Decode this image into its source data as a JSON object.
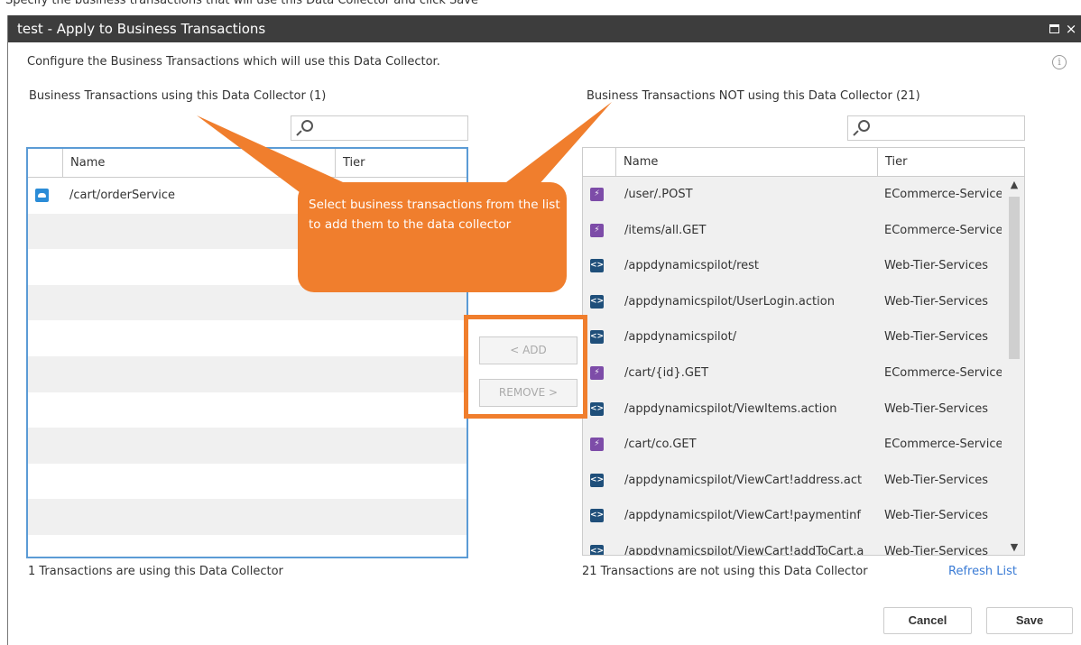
{
  "top_strip": "Specify the business transactions that will use this Data Collector and click Save",
  "dialog": {
    "title": "test - Apply to Business Transactions",
    "description": "Configure the Business Transactions which will use this Data Collector.",
    "close_glyph": "×",
    "info_glyph": "i"
  },
  "left_panel": {
    "label": "Business Transactions using this Data Collector (1)",
    "search_placeholder": "",
    "columns": [
      "Name",
      "Tier"
    ],
    "rows": [
      {
        "name": "/cart/orderService",
        "tier": "",
        "icon": "cloud-icon"
      }
    ],
    "footer": "1 Transactions are using this Data Collector"
  },
  "right_panel": {
    "label": "Business Transactions NOT using this Data Collector (21)",
    "search_placeholder": "",
    "columns": [
      "Name",
      "Tier"
    ],
    "rows": [
      {
        "name": "/user/.POST",
        "tier": "ECommerce-Service",
        "icon": "lightning-icon"
      },
      {
        "name": "/items/all.GET",
        "tier": "ECommerce-Service",
        "icon": "lightning-icon"
      },
      {
        "name": "/appdynamicspilot/rest",
        "tier": "Web-Tier-Services",
        "icon": "code-icon"
      },
      {
        "name": "/appdynamicspilot/UserLogin.action",
        "tier": "Web-Tier-Services",
        "icon": "code-icon"
      },
      {
        "name": "/appdynamicspilot/",
        "tier": "Web-Tier-Services",
        "icon": "code-icon"
      },
      {
        "name": "/cart/{id}.GET",
        "tier": "ECommerce-Service",
        "icon": "lightning-icon"
      },
      {
        "name": "/appdynamicspilot/ViewItems.action",
        "tier": "Web-Tier-Services",
        "icon": "code-icon"
      },
      {
        "name": "/cart/co.GET",
        "tier": "ECommerce-Service",
        "icon": "lightning-icon"
      },
      {
        "name": "/appdynamicspilot/ViewCart!address.act",
        "tier": "Web-Tier-Services",
        "icon": "code-icon"
      },
      {
        "name": "/appdynamicspilot/ViewCart!paymentinf",
        "tier": "Web-Tier-Services",
        "icon": "code-icon"
      },
      {
        "name": "/appdynamicspilot/ViewCart!addToCart.a",
        "tier": "Web-Tier-Services",
        "icon": "code-icon"
      }
    ],
    "footer": "21 Transactions are not using this Data Collector",
    "refresh_label": "Refresh List"
  },
  "buttons": {
    "add": "< ADD",
    "remove": "REMOVE >",
    "cancel": "Cancel",
    "save": "Save"
  },
  "callout": {
    "text": "Select business transactions from the list to add them to the data collector",
    "color": "#f07e2d"
  },
  "colors": {
    "titlebar": "#3d3d3d",
    "selection_border": "#5b9bd5",
    "link": "#3a7bd5",
    "highlight": "#f07e2d"
  }
}
